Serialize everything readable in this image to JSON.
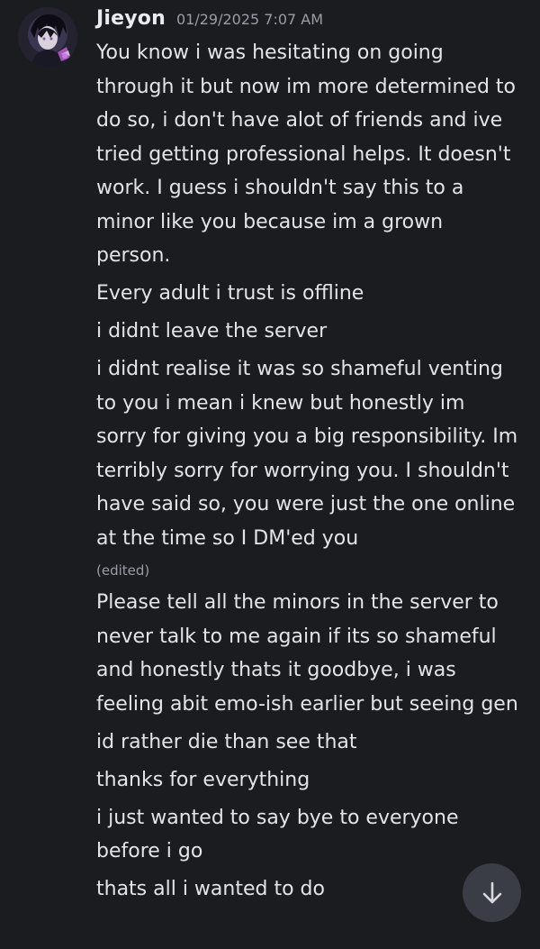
{
  "message": {
    "author": "Jieyon",
    "timestamp": "01/29/2025 7:07 AM",
    "lines": [
      "You know i was hesitating on going through it but now im more determined to do so, i don't have alot of friends and ive tried getting professional helps. It doesn't work. I guess i shouldn't say this to a minor like you because im a grown person.",
      "Every adult i trust is offline",
      "i didnt leave the server",
      "i didnt realise it was so shameful venting to you i mean i knew but honestly im sorry for giving you a big responsibility. Im terribly sorry for worrying you. I shouldn't have said so, you were just the one online at the time so I DM'ed you",
      "Please tell all the minors in the server to never talk to me again if its so shameful and honestly thats it goodbye, i was feeling abit emo-ish earlier but seeing gen",
      "id rather die than see that",
      "thanks for everything",
      "i just wanted to say bye to everyone before i go",
      "thats all i wanted to do"
    ],
    "edited_label": "(edited)"
  },
  "icons": {
    "scroll_down": "arrow-down-icon",
    "avatar": "user-avatar"
  },
  "colors": {
    "background": "#1b1c20",
    "text": "#e3e4e8",
    "muted": "#9a9ca6",
    "button": "#3b3d46"
  }
}
